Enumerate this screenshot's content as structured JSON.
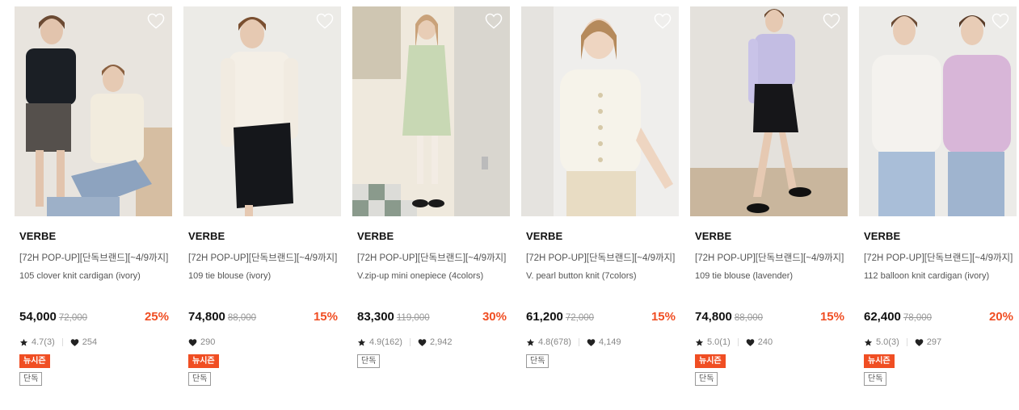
{
  "products": [
    {
      "brand": "VERBE",
      "title": "[72H POP-UP][단독브랜드][~4/9까지]",
      "subtitle": "105 clover knit cardigan (ivory)",
      "price": "54,000",
      "original_price": "72,000",
      "discount": "25%",
      "rating": "4.7(3)",
      "likes": "254",
      "tags": [
        "뉴시즌",
        "단독"
      ]
    },
    {
      "brand": "VERBE",
      "title": "[72H POP-UP][단독브랜드][~4/9까지]",
      "subtitle": "109 tie blouse (ivory)",
      "price": "74,800",
      "original_price": "88,000",
      "discount": "15%",
      "rating": "",
      "likes": "290",
      "tags": [
        "뉴시즌",
        "단독"
      ]
    },
    {
      "brand": "VERBE",
      "title": "[72H POP-UP][단독브랜드][~4/9까지]",
      "subtitle": "V.zip-up mini onepiece (4colors)",
      "price": "83,300",
      "original_price": "119,000",
      "discount": "30%",
      "rating": "4.9(162)",
      "likes": "2,942",
      "tags": [
        "단독"
      ]
    },
    {
      "brand": "VERBE",
      "title": "[72H POP-UP][단독브랜드][~4/9까지]",
      "subtitle": "V. pearl button knit (7colors)",
      "price": "61,200",
      "original_price": "72,000",
      "discount": "15%",
      "rating": "4.8(678)",
      "likes": "4,149",
      "tags": [
        "단독"
      ]
    },
    {
      "brand": "VERBE",
      "title": "[72H POP-UP][단독브랜드][~4/9까지]",
      "subtitle": "109 tie blouse (lavender)",
      "price": "74,800",
      "original_price": "88,000",
      "discount": "15%",
      "rating": "5.0(1)",
      "likes": "240",
      "tags": [
        "뉴시즌",
        "단독"
      ]
    },
    {
      "brand": "VERBE",
      "title": "[72H POP-UP][단독브랜드][~4/9까지]",
      "subtitle": "112 balloon knit cardigan (ivory)",
      "price": "62,400",
      "original_price": "78,000",
      "discount": "20%",
      "rating": "5.0(3)",
      "likes": "297",
      "tags": [
        "뉴시즌",
        "단독"
      ]
    }
  ],
  "icons": {
    "wishlist": "heart-outline-icon",
    "rating": "star-icon",
    "likes": "heart-filled-icon"
  },
  "colors": {
    "discount": "#f04e23",
    "new_season_tag": "#f04e23",
    "text": "#111111",
    "muted": "#888888"
  }
}
